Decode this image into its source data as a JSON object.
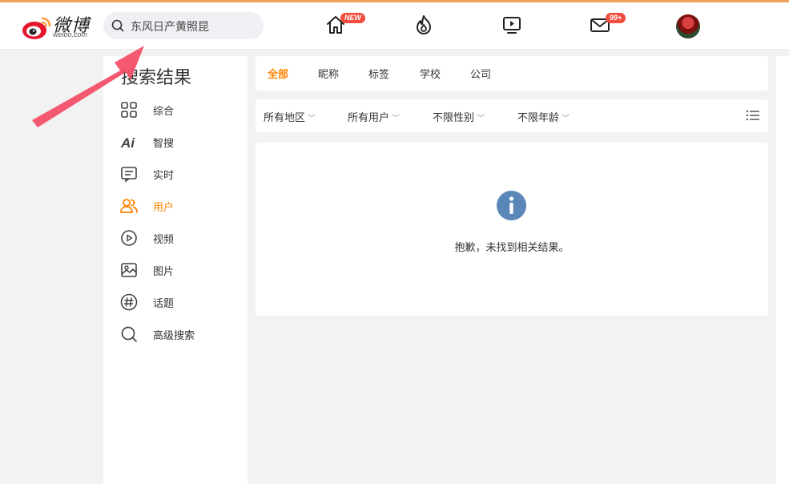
{
  "header": {
    "logo_text": "微博",
    "logo_sub": "weibo.com",
    "search_value": "东风日产黄照昆",
    "nav": [
      {
        "icon": "home-icon",
        "badge": "NEW"
      },
      {
        "icon": "hot-fire-icon",
        "badge": ""
      },
      {
        "icon": "video-play-icon",
        "badge": ""
      },
      {
        "icon": "mail-icon",
        "badge": "99+"
      }
    ]
  },
  "sidebar": {
    "title": "搜索结果",
    "items": [
      {
        "label": "综合",
        "icon": "grid-icon"
      },
      {
        "label": "智搜",
        "icon": "ai-icon"
      },
      {
        "label": "实时",
        "icon": "realtime-chat-icon"
      },
      {
        "label": "用户",
        "icon": "users-icon",
        "active": true
      },
      {
        "label": "视频",
        "icon": "video-icon"
      },
      {
        "label": "图片",
        "icon": "image-icon"
      },
      {
        "label": "话题",
        "icon": "hashtag-icon"
      },
      {
        "label": "高级搜索",
        "icon": "search-icon"
      }
    ]
  },
  "tabs": [
    "全部",
    "昵称",
    "标签",
    "学校",
    "公司"
  ],
  "filters": [
    "所有地区",
    "所有用户",
    "不限性别",
    "不限年龄"
  ],
  "results": {
    "empty_message": "抱歉，未找到相关结果。"
  },
  "colors": {
    "accent": "#ff8200",
    "badge": "#f14c3d",
    "info_icon": "#5b87b8",
    "annotation_arrow": "#f4506a"
  }
}
